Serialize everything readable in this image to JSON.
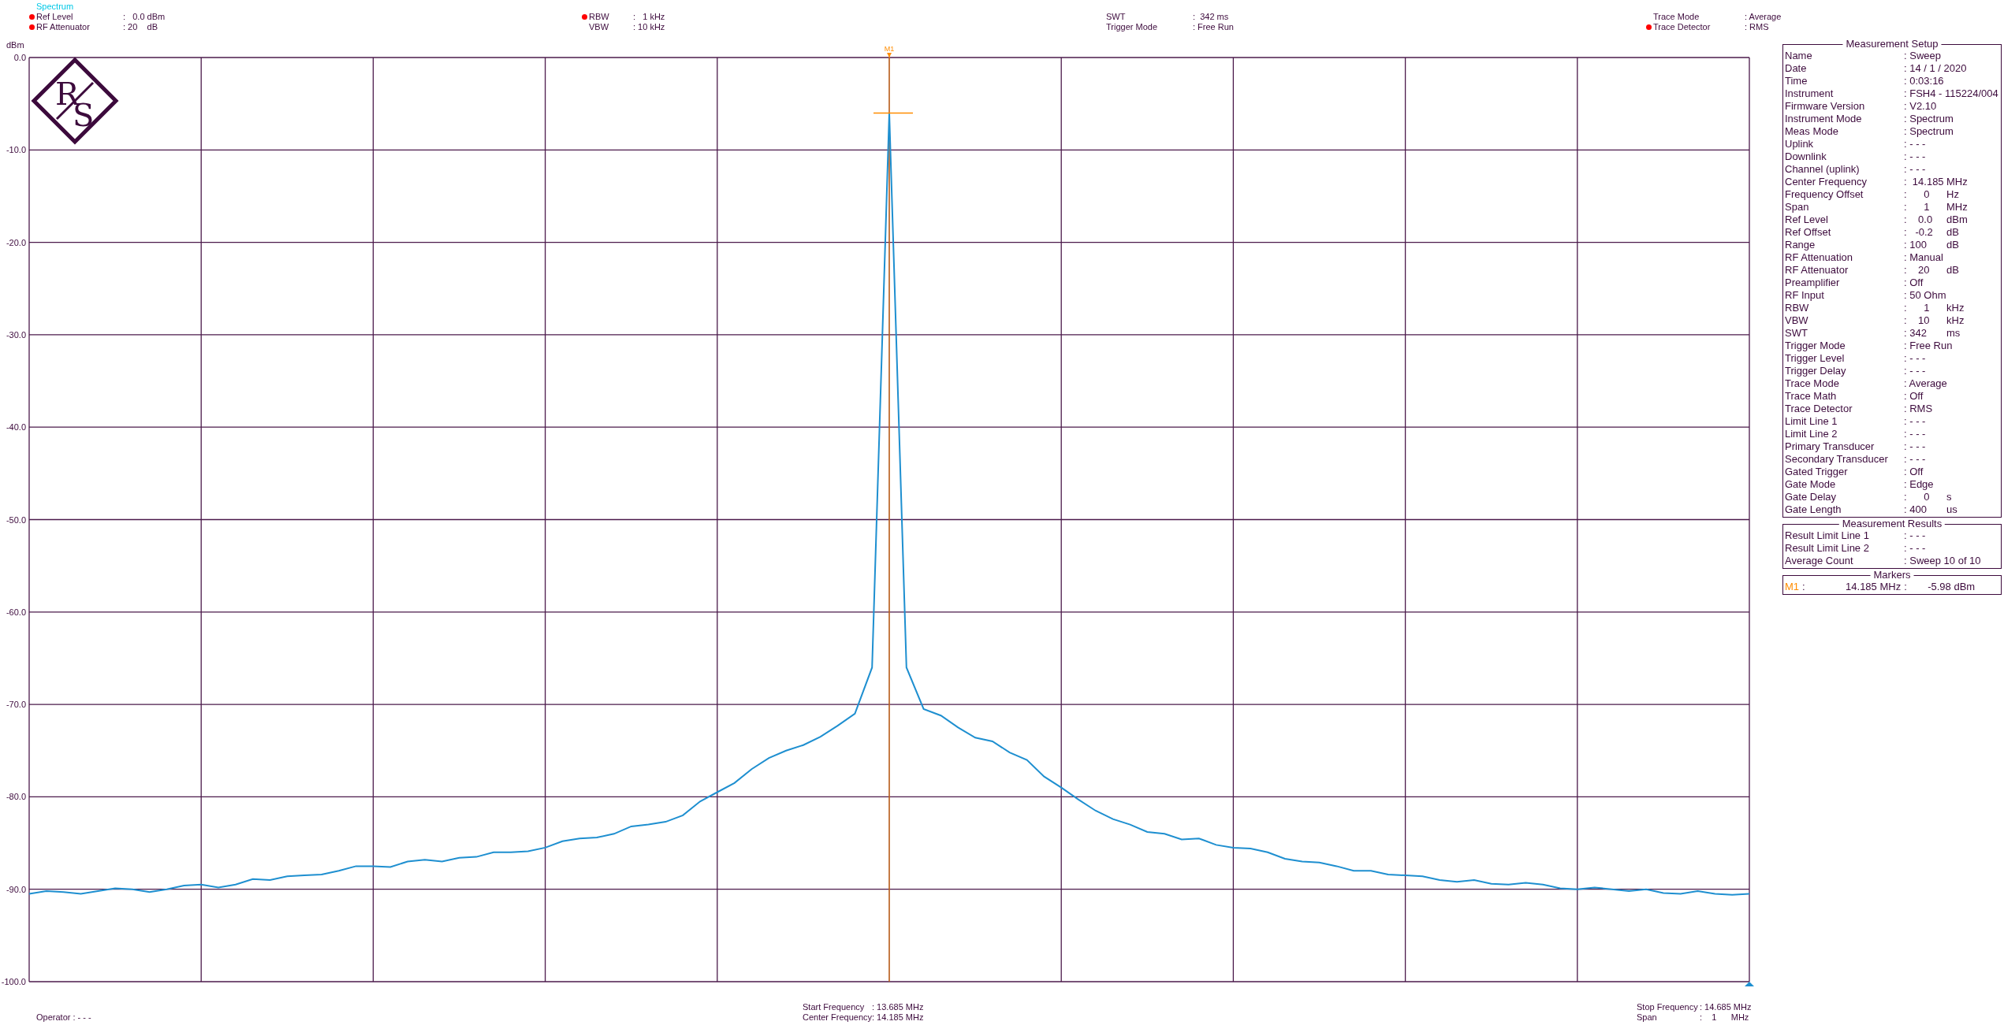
{
  "header": {
    "title": "Spectrum",
    "groups": [
      [
        {
          "flagged": true,
          "label": "Ref Level",
          "value": ":   0.0 dBm"
        },
        {
          "flagged": true,
          "label": "RF Attenuator",
          "value": ": 20    dB"
        }
      ],
      [
        {
          "flagged": true,
          "label": "RBW",
          "value": ":   1 kHz"
        },
        {
          "flagged": false,
          "label": "VBW",
          "value": ": 10 kHz"
        }
      ],
      [
        {
          "flagged": false,
          "label": "SWT",
          "value": ":  342 ms"
        },
        {
          "flagged": false,
          "label": "Trigger Mode",
          "value": ": Free Run"
        }
      ],
      [
        {
          "flagged": false,
          "label": "Trace Mode",
          "value": ": Average"
        },
        {
          "flagged": true,
          "label": "Trace Detector",
          "value": ": RMS"
        }
      ]
    ]
  },
  "plot": {
    "logo": {
      "letter_1": "R",
      "letter_2": "S"
    },
    "chart_data": {
      "type": "line",
      "ylabel": "dBm",
      "ylim": [
        -100,
        0
      ],
      "grid": true,
      "yticks": [
        {
          "value": 0,
          "label": "0.0"
        },
        {
          "value": -10,
          "label": "-10.0"
        },
        {
          "value": -20,
          "label": "-20.0"
        },
        {
          "value": -30,
          "label": "-30.0"
        },
        {
          "value": -40,
          "label": "-40.0"
        },
        {
          "value": -50,
          "label": "-50.0"
        },
        {
          "value": -60,
          "label": "-60.0"
        },
        {
          "value": -70,
          "label": "-70.0"
        },
        {
          "value": -80,
          "label": "-80.0"
        },
        {
          "value": -90,
          "label": "-90.0"
        },
        {
          "value": -100,
          "label": "-100.0"
        }
      ],
      "categories": [
        null,
        null,
        null,
        null,
        null,
        null,
        null,
        null,
        null,
        null,
        null,
        null,
        null,
        null,
        null,
        null,
        null,
        null,
        null,
        null,
        null,
        null,
        null,
        null,
        null,
        null,
        null,
        null,
        null,
        null,
        null,
        null,
        null,
        null,
        null,
        null,
        null,
        null,
        null,
        null,
        null,
        null,
        null,
        null,
        null,
        null,
        null,
        null,
        null,
        null,
        null,
        null,
        null,
        null,
        null,
        null,
        null,
        null,
        null,
        null,
        null,
        null,
        null,
        null,
        null,
        null,
        null,
        null,
        null,
        null,
        null,
        null,
        null,
        null,
        null,
        null,
        null,
        null,
        null,
        null,
        null,
        null,
        null,
        null,
        null,
        null,
        null,
        null,
        null,
        null,
        null,
        null,
        null,
        null,
        null,
        null,
        null,
        null,
        null,
        null,
        null
      ],
      "series": [
        {
          "color": "#1e8fd0",
          "values": [
            -90.5,
            -90.2,
            -90.3,
            -90.5,
            -90.2,
            -89.9,
            -90,
            -90.3,
            -90,
            -89.6,
            -89.5,
            -89.8,
            -89.5,
            -88.9,
            -89,
            -88.6,
            -88.5,
            -88.4,
            -88,
            -87.5,
            -87.5,
            -87.6,
            -87,
            -86.8,
            -87,
            -86.6,
            -86.5,
            -86,
            -86,
            -85.9,
            -85.5,
            -84.8,
            -84.5,
            -84.4,
            -84,
            -83.2,
            -83,
            -82.7,
            -82,
            -80.5,
            -79.5,
            -78.5,
            -77,
            -75.8,
            -75,
            -74.4,
            -73.5,
            -72.3,
            -71,
            -66,
            -6,
            -66,
            -70.5,
            -71.2,
            -72.5,
            -73.6,
            -74,
            -75.2,
            -76,
            -77.8,
            -79,
            -80.3,
            -81.5,
            -82.4,
            -83,
            -83.8,
            -84,
            -84.6,
            -84.5,
            -85.2,
            -85.5,
            -85.6,
            -86,
            -86.7,
            -87,
            -87.1,
            -87.5,
            -88,
            -88,
            -88.4,
            -88.5,
            -88.6,
            -89,
            -89.2,
            -89,
            -89.4,
            -89.5,
            -89.3,
            -89.5,
            -89.9,
            -90,
            -89.8,
            -90,
            -90.2,
            -90,
            -90.4,
            -90.5,
            -90.2,
            -90.5,
            -90.6,
            -90.5
          ]
        }
      ],
      "annotations": [
        {
          "text": "M1"
        }
      ]
    }
  },
  "footer": {
    "operator": "Operator : - - -",
    "center_block": [
      {
        "label": "Start Frequency",
        "value": ": 13.685 MHz"
      },
      {
        "label": "Center Frequency",
        "value": ": 14.185 MHz"
      }
    ],
    "right_block": [
      {
        "label": "Stop Frequency",
        "value": ": 14.685 MHz"
      },
      {
        "label": "Span",
        "value": ":    1      MHz"
      }
    ]
  },
  "panels": [
    {
      "title": "Measurement Setup",
      "rows": [
        {
          "label": "Name",
          "value": ": Sweep"
        },
        {
          "label": "Date",
          "value": ": 14 / 1 / 2020"
        },
        {
          "label": "Time",
          "value": ": 0:03:16"
        },
        {
          "label": "Instrument",
          "value": ": FSH4 - 115224/004"
        },
        {
          "label": "Firmware Version",
          "value": ": V2.10"
        },
        {
          "label": "Instrument Mode",
          "value": ": Spectrum"
        },
        {
          "label": "Meas Mode",
          "value": ": Spectrum"
        },
        {
          "label": "Uplink",
          "value": ": - - -"
        },
        {
          "label": "Downlink",
          "value": ": - - -"
        },
        {
          "label": "Channel (uplink)",
          "value": ": - - -"
        },
        {
          "label": "Center Frequency",
          "value": ":  14.185",
          "unit": "MHz"
        },
        {
          "label": "Frequency Offset",
          "value": ":      0",
          "unit": "Hz"
        },
        {
          "label": "Span",
          "value": ":      1",
          "unit": "MHz"
        },
        {
          "label": "Ref Level",
          "value": ":    0.0",
          "unit": "dBm"
        },
        {
          "label": "Ref Offset",
          "value": ":   -0.2",
          "unit": "dB"
        },
        {
          "label": "Range",
          "value": ": 100",
          "unit": "dB"
        },
        {
          "label": "RF Attenuation",
          "value": ": Manual"
        },
        {
          "label": "RF Attenuator",
          "value": ":    20",
          "unit": "dB"
        },
        {
          "label": "Preamplifier",
          "value": ": Off"
        },
        {
          "label": "RF Input",
          "value": ": 50 Ohm"
        },
        {
          "label": "RBW",
          "value": ":      1",
          "unit": "kHz"
        },
        {
          "label": "VBW",
          "value": ":    10",
          "unit": "kHz"
        },
        {
          "label": "SWT",
          "value": ": 342",
          "unit": "ms"
        },
        {
          "label": "Trigger Mode",
          "value": ": Free Run"
        },
        {
          "label": "Trigger Level",
          "value": ": - - -"
        },
        {
          "label": "Trigger Delay",
          "value": ": - - -"
        },
        {
          "label": "Trace Mode",
          "value": ": Average"
        },
        {
          "label": "Trace Math",
          "value": ": Off"
        },
        {
          "label": "Trace Detector",
          "value": ": RMS"
        },
        {
          "label": "Limit Line 1",
          "value": ": - - -"
        },
        {
          "label": "Limit Line 2",
          "value": ": - - -"
        },
        {
          "label": "Primary Transducer",
          "value": ": - - -"
        },
        {
          "label": "Secondary Transducer",
          "value": ": - - -"
        },
        {
          "label": "Gated Trigger",
          "value": ": Off"
        },
        {
          "label": "Gate Mode",
          "value": ": Edge"
        },
        {
          "label": "Gate Delay",
          "value": ":      0",
          "unit": "s"
        },
        {
          "label": "Gate Length",
          "value": ": 400",
          "unit": "us"
        }
      ]
    },
    {
      "title": "Measurement Results",
      "rows": [
        {
          "label": "Result Limit Line 1",
          "value": ": - - -"
        },
        {
          "label": "Result Limit Line 2",
          "value": ": - - -"
        },
        {
          "label": "Average Count",
          "value": ": Sweep 10 of 10"
        }
      ]
    }
  ],
  "markers": {
    "title": "Markers",
    "label": "M1",
    "separator_1": ":",
    "frequency": "14.185 MHz",
    "separator_2": ":",
    "level": "-5.98 dBm"
  }
}
